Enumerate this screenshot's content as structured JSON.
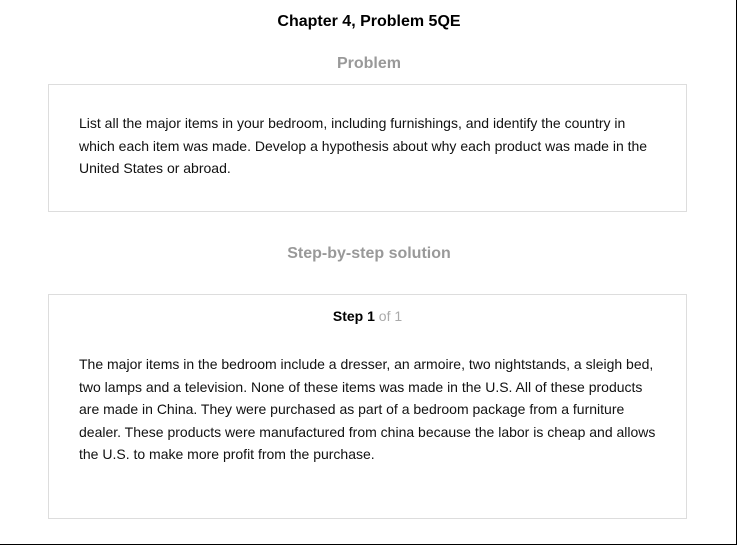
{
  "header": {
    "title": "Chapter 4, Problem 5QE"
  },
  "problem": {
    "heading": "Problem",
    "text": "List all the major items in your bedroom, including furnishings, and identify the country in which each item was made. Develop a hypothesis about why each product was made in the United States or abroad."
  },
  "solution": {
    "heading": "Step-by-step solution",
    "step_word": "Step",
    "step_number": "1",
    "step_of": "of 1",
    "text": "The major items in the bedroom include a dresser, an armoire, two nightstands, a sleigh bed, two lamps and a television. None of these items was made in the U.S. All of these products are made in China. They were purchased as part of a bedroom package from a furniture dealer. These products were manufactured from china because the labor is cheap and allows the U.S. to make more profit from the purchase."
  }
}
